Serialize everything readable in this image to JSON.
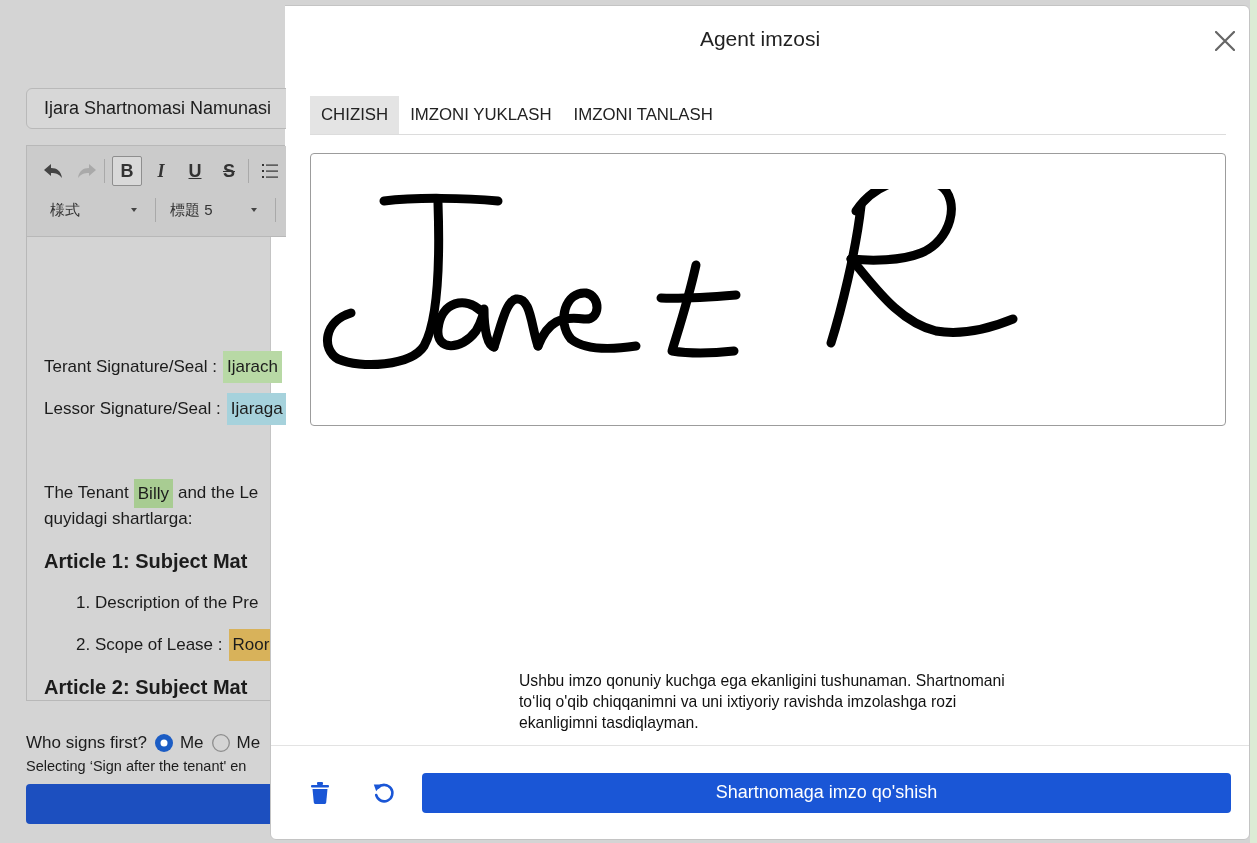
{
  "document": {
    "title_field": {
      "value": "Ijara Shartnomasi Namunasi"
    },
    "toolbar": {
      "buttons": [
        {
          "kind": "undo",
          "disabled": false
        },
        {
          "kind": "redo",
          "disabled": true
        },
        {
          "kind": "bold",
          "label": "B",
          "selected": true
        },
        {
          "kind": "italic",
          "label": "I",
          "selected": false
        },
        {
          "kind": "underline",
          "label": "U",
          "selected": false
        },
        {
          "kind": "strike",
          "label": "S",
          "selected": false
        },
        {
          "kind": "list"
        }
      ],
      "dropdowns": [
        {
          "value": "様式"
        },
        {
          "value": "標題 5"
        }
      ]
    },
    "signature_lines": [
      {
        "label": "Terant Signature/Seal :",
        "value": "Ijarach",
        "color": "#b8d9a5"
      },
      {
        "label": "Lessor Signature/Seal :",
        "value": "Ijaraga",
        "color": "#a6d2dc"
      }
    ],
    "intro_lines": [
      [
        {
          "text": "The Tenant"
        },
        {
          "text": "Billy",
          "color": "#a8cc92"
        },
        {
          "text": "and the Le"
        }
      ],
      [
        {
          "text": "quyidagi shartlarga:"
        }
      ]
    ],
    "sections": [
      {
        "heading": "Article 1: Subject Mat",
        "items": [
          [
            {
              "text": "1. Description of the Pre"
            }
          ],
          [
            {
              "text": "2. Scope of Lease :"
            },
            {
              "text": "Roor",
              "color": "#d8b25a"
            }
          ]
        ]
      },
      {
        "heading": "Article 2: Subject Mat"
      }
    ]
  },
  "signing_order": {
    "label": "Who signs first?",
    "options": [
      {
        "label": "Me",
        "selected": true
      },
      {
        "label": "Me",
        "selected": false
      }
    ],
    "hint": "Selecting ‘Sign after the tenant' en"
  },
  "dialog": {
    "title": "Agent imzosi",
    "tabs": [
      {
        "label": "CHIZISH",
        "selected": true
      },
      {
        "label": "IMZONI YUKLASH",
        "selected": false
      },
      {
        "label": "IMZONI TANLASH",
        "selected": false
      }
    ],
    "consent_text": "Ushbu imzo qonuniy kuchga ega ekanligini tushunaman. Shartnomani to‘liq o'qib chiqqanimni va uni ixtiyoriy ravishda imzolashga rozi ekanligimni tasdiqlayman.",
    "confirm_button": "Shartnomaga imzo qo'shish"
  }
}
